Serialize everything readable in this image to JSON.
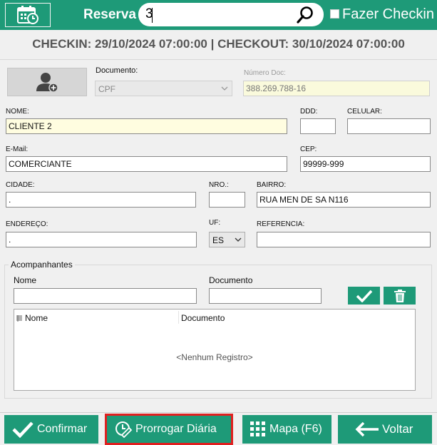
{
  "header": {
    "reserva_label": "Reserva",
    "search_value": "3",
    "checkin_label": "Fazer Checkin"
  },
  "dates_text": "CHECKIN: 29/10/2024 07:00:00  |  CHECKOUT: 30/10/2024 07:00:00",
  "form": {
    "documento_label": "Documento:",
    "documento_value": "CPF",
    "numero_doc_label": "Número Doc:",
    "numero_doc_value": "388.269.788-16",
    "nome_label": "NOME:",
    "nome_value": "CLIENTE 2",
    "ddd_label": "DDD:",
    "ddd_value": "",
    "celular_label": "CELULAR:",
    "celular_value": "",
    "email_label": "E-Mail:",
    "email_value": "COMERCIANTE",
    "cep_label": "CEP:",
    "cep_value": "99999-999",
    "cidade_label": "CIDADE:",
    "cidade_value": ".",
    "nro_label": "NRO.:",
    "nro_value": "",
    "bairro_label": "BAIRRO:",
    "bairro_value": "RUA MEN DE SA N116",
    "endereco_label": "ENDEREÇO:",
    "endereco_value": ".",
    "uf_label": "UF:",
    "uf_value": "ES",
    "referencia_label": "REFERENCIA:",
    "referencia_value": ""
  },
  "acompanhantes": {
    "title": "Acompanhantes",
    "nome_label": "Nome",
    "documento_label": "Documento",
    "columns": [
      "Nome",
      "Documento"
    ],
    "empty_text": "<Nenhum Registro>"
  },
  "footer": {
    "confirmar": "Confirmar",
    "prorrogar": "Prorrogar Diária",
    "mapa": "Mapa (F6)",
    "voltar": "Voltar"
  },
  "colors": {
    "accent": "#1e9a78",
    "highlight": "#e02020"
  }
}
